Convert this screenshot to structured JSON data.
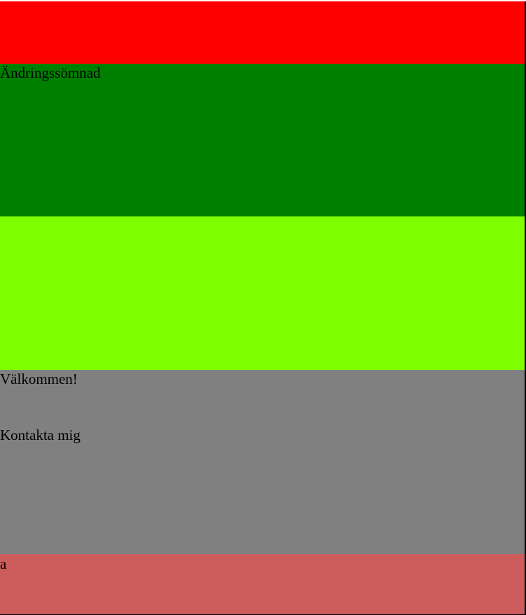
{
  "colors": {
    "header": "#ff0000",
    "title_section": "#008000",
    "banner": "#7fff00",
    "content": "#808080",
    "footer": "#cd5c5c"
  },
  "title": {
    "text": "Ändringssömnad"
  },
  "content": {
    "welcome": "Välkommen!",
    "contact_link": "Kontakta mig"
  },
  "footer": {
    "text": "a"
  }
}
